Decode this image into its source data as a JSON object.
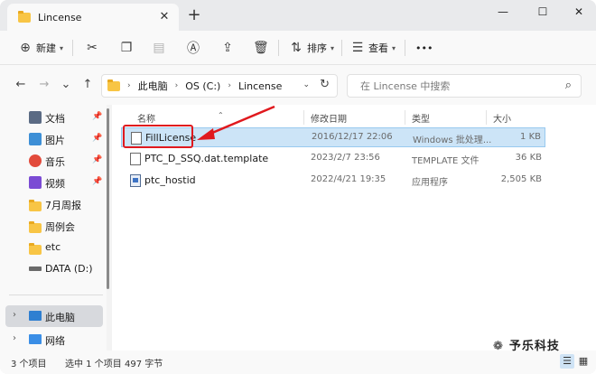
{
  "window": {
    "tab_title": "Lincense"
  },
  "toolbar": {
    "new_label": "新建",
    "sort_label": "排序",
    "view_label": "查看",
    "more_label": "•••"
  },
  "address": {
    "crumbs": [
      "此电脑",
      "OS (C:)",
      "Lincense"
    ],
    "search_placeholder": "在 Lincense 中搜索"
  },
  "sidebar": {
    "quick": [
      {
        "label": "文档",
        "icon": "documents-icon",
        "color": "#5b6b84"
      },
      {
        "label": "图片",
        "icon": "pictures-icon",
        "color": "#3d8fd6"
      },
      {
        "label": "音乐",
        "icon": "music-icon",
        "color": "#e24a3b"
      },
      {
        "label": "视频",
        "icon": "videos-icon",
        "color": "#7b4bd4"
      },
      {
        "label": "7月周报",
        "icon": "folder-icon"
      },
      {
        "label": "周例会",
        "icon": "folder-icon"
      },
      {
        "label": "etc",
        "icon": "folder-icon"
      },
      {
        "label": "DATA (D:)",
        "icon": "drive-icon"
      }
    ],
    "this_pc": "此电脑",
    "network": "网络"
  },
  "columns": {
    "name": "名称",
    "modified": "修改日期",
    "type": "类型",
    "size": "大小"
  },
  "files": [
    {
      "name": "FillLicense",
      "modified": "2016/12/17 22:06",
      "type": "Windows 批处理...",
      "size": "1 KB",
      "selected": true
    },
    {
      "name": "PTC_D_SSQ.dat.template",
      "modified": "2023/2/7 23:56",
      "type": "TEMPLATE 文件",
      "size": "36 KB"
    },
    {
      "name": "ptc_hostid",
      "modified": "2022/4/21 19:35",
      "type": "应用程序",
      "size": "2,505 KB"
    }
  ],
  "status": {
    "count": "3 个项目",
    "selection": "选中 1 个项目",
    "selection_size": "497 字节"
  },
  "watermark": "予乐科技",
  "colors": {
    "accent": "#0067c0",
    "highlight": "#cce4f7",
    "annotation": "#e0191e"
  }
}
